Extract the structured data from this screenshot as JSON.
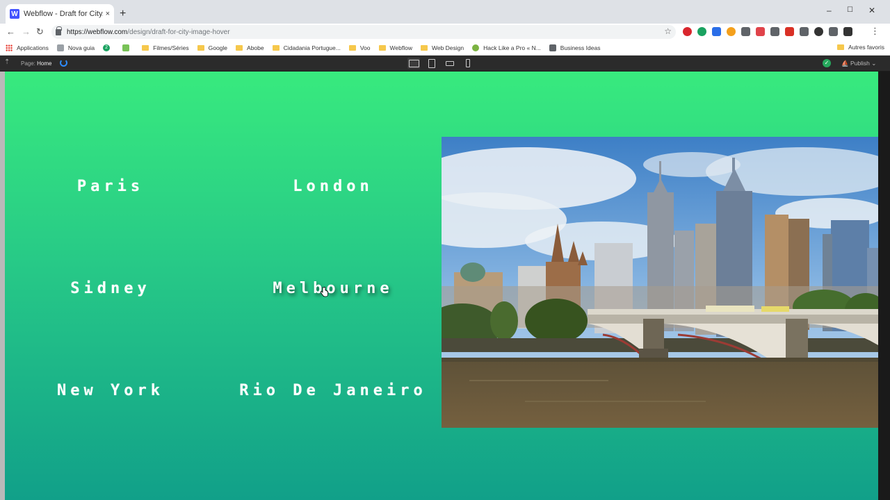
{
  "browser": {
    "tab_icon": "W",
    "tab_title": "Webflow - Draft for City/Image H",
    "tab_close": "×",
    "new_tab": "+",
    "window_controls": {
      "minimize": "–",
      "maximize": "☐",
      "close": "✕"
    },
    "nav": {
      "back": "←",
      "forward": "→",
      "reload": "↻"
    },
    "url_host": "https://webflow.com",
    "url_path": "/design/draft-for-city-image-hover",
    "star": "☆",
    "menu": "⋮",
    "extension_colors": [
      "#d9262d",
      "#1aa260",
      "#2a6ee8",
      "#f4a01c",
      "#5f6368",
      "#e0434a",
      "#5f6368",
      "#d93025",
      "#5f6368",
      "#333333",
      "#5f6368",
      "#333333"
    ]
  },
  "bookmarks": {
    "items": [
      {
        "label": "Applications",
        "icon": "apps-grid-icon"
      },
      {
        "label": "Nova guia",
        "icon": "page-icon"
      },
      {
        "label": "",
        "icon": "badge-2-icon"
      },
      {
        "label": "",
        "icon": "android-icon"
      },
      {
        "label": "Filmes/Séries",
        "icon": "folder-icon"
      },
      {
        "label": "Google",
        "icon": "folder-icon"
      },
      {
        "label": "Abobe",
        "icon": "folder-icon"
      },
      {
        "label": "Cidadania Portugue...",
        "icon": "folder-icon"
      },
      {
        "label": "Voo",
        "icon": "folder-icon"
      },
      {
        "label": "Webflow",
        "icon": "folder-icon"
      },
      {
        "label": "Web Design",
        "icon": "folder-icon"
      },
      {
        "label": "Hack Like a Pro « N...",
        "icon": "hack-icon"
      },
      {
        "label": "Business Ideas",
        "icon": "bookmark-icon"
      }
    ],
    "badge_2": "2",
    "right_label": "Autres favoris"
  },
  "designer": {
    "page_label": "Page:",
    "page_name": "Home",
    "publish_label": "Publish",
    "publish_caret": "⌄",
    "status_check": "✓"
  },
  "cities": [
    "Paris",
    "London",
    "Sidney",
    "Melbourne",
    "New York",
    "Rio De Janeiro"
  ],
  "hovered_city": "Melbourne",
  "photo": {
    "subject": "melbourne-skyline-bridge"
  }
}
